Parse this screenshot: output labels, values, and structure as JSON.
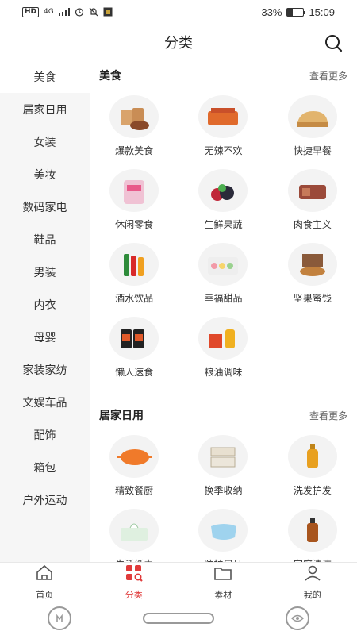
{
  "status_bar": {
    "network": "HD",
    "signal": "4G",
    "battery_percent": "33%",
    "time": "15:09",
    "battery_level": 0.33
  },
  "header": {
    "title": "分类"
  },
  "colors": {
    "accent": "#e03b3b",
    "sidebar_bg": "#f6f6f6"
  },
  "sidebar": {
    "items": [
      {
        "label": "美食",
        "active": true
      },
      {
        "label": "居家日用"
      },
      {
        "label": "女装"
      },
      {
        "label": "美妆"
      },
      {
        "label": "数码家电"
      },
      {
        "label": "鞋品"
      },
      {
        "label": "男装"
      },
      {
        "label": "内衣"
      },
      {
        "label": "母婴"
      },
      {
        "label": "家装家纺"
      },
      {
        "label": "文娱车品"
      },
      {
        "label": "配饰"
      },
      {
        "label": "箱包"
      },
      {
        "label": "户外运动"
      }
    ]
  },
  "sections": [
    {
      "title": "美食",
      "more": "查看更多",
      "items": [
        {
          "label": "爆款美食",
          "icon": "snack-food-icon"
        },
        {
          "label": "无辣不欢",
          "icon": "spicy-food-icon"
        },
        {
          "label": "快捷早餐",
          "icon": "bread-icon"
        },
        {
          "label": "休闲零食",
          "icon": "chips-icon"
        },
        {
          "label": "生鲜果蔬",
          "icon": "fruit-icon"
        },
        {
          "label": "肉食主义",
          "icon": "meat-icon"
        },
        {
          "label": "酒水饮品",
          "icon": "drinks-icon"
        },
        {
          "label": "幸福甜品",
          "icon": "macaron-icon"
        },
        {
          "label": "坚果蜜饯",
          "icon": "nuts-icon"
        },
        {
          "label": "懒人速食",
          "icon": "noodles-icon"
        },
        {
          "label": "粮油调味",
          "icon": "oil-rice-icon"
        }
      ]
    },
    {
      "title": "居家日用",
      "more": "查看更多",
      "items": [
        {
          "label": "精致餐厨",
          "icon": "pot-icon"
        },
        {
          "label": "换季收纳",
          "icon": "storage-box-icon"
        },
        {
          "label": "洗发护发",
          "icon": "shampoo-icon"
        },
        {
          "label": "生活纸巾",
          "icon": "tissue-icon"
        },
        {
          "label": "防护用品",
          "icon": "mask-icon"
        },
        {
          "label": "家庭清洁",
          "icon": "cleaner-icon"
        }
      ]
    }
  ],
  "tabbar": {
    "items": [
      {
        "label": "首页",
        "icon": "home-icon"
      },
      {
        "label": "分类",
        "icon": "category-icon",
        "active": true
      },
      {
        "label": "素材",
        "icon": "folder-icon"
      },
      {
        "label": "我的",
        "icon": "user-icon"
      }
    ]
  }
}
